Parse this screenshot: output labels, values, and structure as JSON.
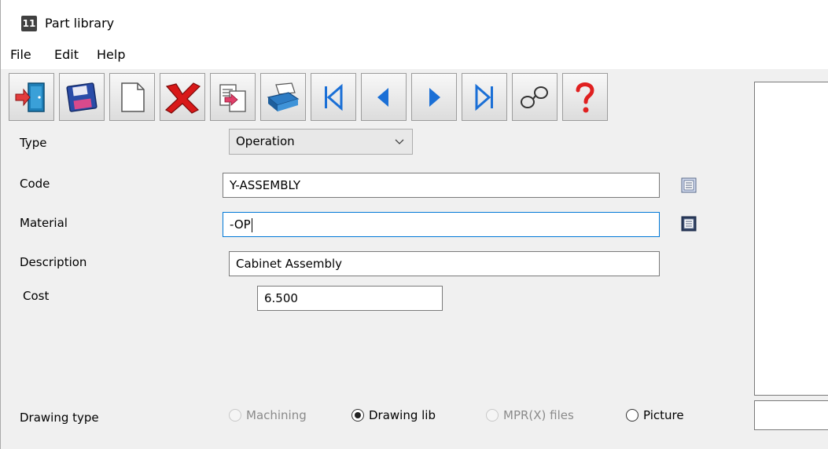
{
  "window": {
    "title": "Part library",
    "icon_label": "11"
  },
  "menu": {
    "items": [
      "File",
      "Edit",
      "Help"
    ]
  },
  "toolbar": {
    "buttons": [
      {
        "name": "exit-button",
        "icon": "exit-door-icon"
      },
      {
        "name": "save-button",
        "icon": "floppy-disk-icon"
      },
      {
        "name": "new-button",
        "icon": "blank-page-icon"
      },
      {
        "name": "delete-button",
        "icon": "red-x-icon"
      },
      {
        "name": "copy-button",
        "icon": "copy-document-icon"
      },
      {
        "name": "print-button",
        "icon": "printer-icon"
      },
      {
        "name": "first-record-button",
        "icon": "first-icon"
      },
      {
        "name": "previous-record-button",
        "icon": "previous-icon"
      },
      {
        "name": "next-record-button",
        "icon": "next-icon"
      },
      {
        "name": "last-record-button",
        "icon": "last-icon"
      },
      {
        "name": "find-button",
        "icon": "glasses-icon"
      },
      {
        "name": "help-button",
        "icon": "question-mark-icon"
      }
    ]
  },
  "form": {
    "type_label": "Type",
    "type_value": "Operation",
    "code_label": "Code",
    "code_value": "Y-ASSEMBLY",
    "material_label": "Material",
    "material_value": "-OP",
    "description_label": "Description",
    "description_value": "Cabinet Assembly",
    "cost_label": "Cost",
    "cost_value": "6.500",
    "drawing_type_label": "Drawing type",
    "drawing_options": [
      {
        "label": "Machining",
        "selected": false,
        "enabled": false
      },
      {
        "label": "Drawing lib",
        "selected": true,
        "enabled": true
      },
      {
        "label": "MPR(X) files",
        "selected": false,
        "enabled": false
      },
      {
        "label": "Picture",
        "selected": false,
        "enabled": true
      }
    ]
  },
  "colors": {
    "accent_focus": "#0078d7",
    "nav_blue": "#1a6fd6",
    "delete_red": "#d81818",
    "help_red": "#e02020"
  }
}
